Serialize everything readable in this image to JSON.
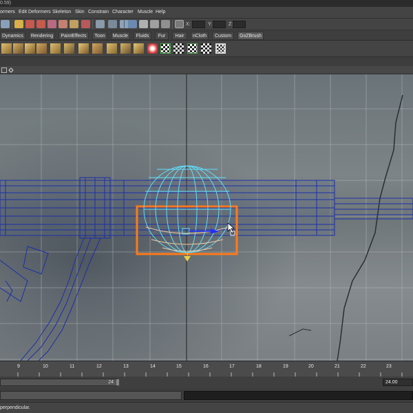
{
  "window": {
    "title_fragment": "0.59)"
  },
  "menu": [
    "ormers",
    "Edit Deformers",
    "Skeleton",
    "Skin",
    "Constrain",
    "Character",
    "Muscle",
    "Help"
  ],
  "status_line": {
    "icons": [
      "snap-grid-icon",
      "snap-curve-icon",
      "snap-point-icon",
      "snap-view-plane-icon",
      "history-icon",
      "render-frame-icon",
      "ipr-render-icon",
      "render-settings-icon",
      "hypershade-icon",
      "camera-icon"
    ],
    "fields": [
      {
        "label": "X:",
        "value": ""
      },
      {
        "label": "Y:",
        "value": ""
      },
      {
        "label": "Z:",
        "value": ""
      }
    ]
  },
  "shelf_tabs": [
    "Dynamics",
    "Rendering",
    "PaintEffects",
    "Toon",
    "Muscle",
    "Fluids",
    "Fur",
    "Hair",
    "nCloth",
    "Custom",
    "GoZBrush"
  ],
  "shelf_icons": [
    "polygon-plane-icon",
    "polygon-cube-icon",
    "extrude-icon",
    "bridge-icon",
    "bevel-icon",
    "wedge-icon",
    "cut-faces-icon",
    "split-polygon-icon",
    "insert-edge-loop-icon",
    "merge-vertices-icon",
    "poke-face-icon",
    "smooth-icon",
    "mirror-icon",
    "uv-checker-icon",
    "uv-checker-icon",
    "uv-checker-icon",
    "uv-checker-icon",
    "uv-texture-editor-icon"
  ],
  "viewport": {
    "scene": "Perspective view with background reference photograph and a wireframe rifle model; a sphere primitive is selected with its manipulator.",
    "selection_color": "#ff7a1a",
    "wire_color": "#1a2fa8",
    "sphere_color": "#5fe0ff"
  },
  "timeline": {
    "ticks": [
      "9",
      "10",
      "11",
      "12",
      "13",
      "14",
      "15",
      "16",
      "17",
      "18",
      "19",
      "20",
      "21",
      "22",
      "23"
    ],
    "range_end_label": "24",
    "end_time_value": "24.00"
  },
  "command_line": {
    "input": "",
    "result": ""
  },
  "help_line": {
    "text": "perpendicular."
  }
}
